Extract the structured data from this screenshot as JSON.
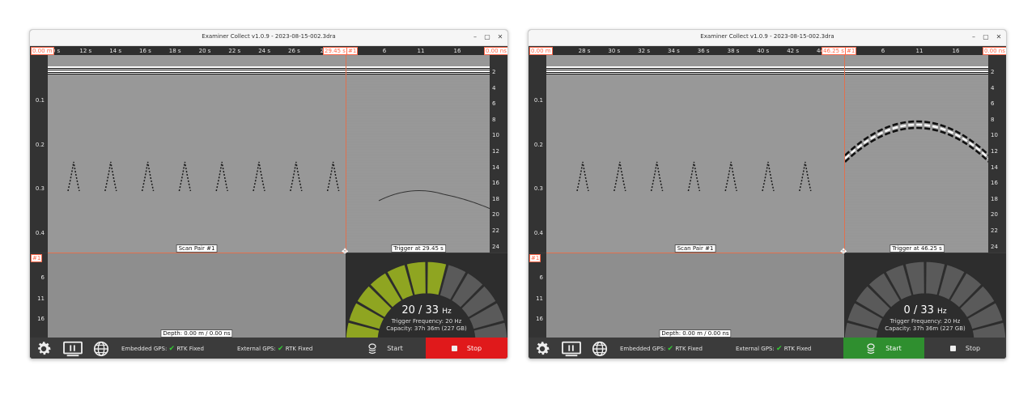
{
  "windows": [
    {
      "title": "Examiner Collect v1.0.9 - 2023-08-15-002.3dra",
      "top_axis_ticks": [
        "0 s",
        "12 s",
        "14 s",
        "16 s",
        "18 s",
        "20 s",
        "22 s",
        "24 s",
        "26 s",
        "28"
      ],
      "start_distance": "0.00 m",
      "cursor_time": "29.45 s",
      "cursor_tag": "#1",
      "ascan_ticks": [
        "6",
        "11",
        "16"
      ],
      "ascan_range": "0.00 ns",
      "depth_ticks": [
        "0.1",
        "0.2",
        "0.3",
        "0.4"
      ],
      "ns_ticks": [
        "2",
        "4",
        "6",
        "8",
        "10",
        "12",
        "14",
        "16",
        "18",
        "20",
        "22",
        "24"
      ],
      "lower_ticks": [
        "6",
        "11",
        "16"
      ],
      "lower_tag": "#1",
      "scan_pair_label": "Scan Pair #1",
      "trigger_label": "Trigger at 29.45 s",
      "depth_label": "Depth: 0.00 m / 0.00 ns",
      "rate_value": "20 / 33",
      "rate_unit": "Hz",
      "trigger_frequency": "Trigger Frequency: 20 Hz",
      "capacity": "Capacity: 37h 36m (227 GB)",
      "gauge_active_fraction": 0.61,
      "embedded_gps_label": "Embedded GPS:",
      "embedded_gps_status": "RTK Fixed",
      "external_gps_label": "External GPS:",
      "external_gps_status": "RTK Fixed",
      "start_label": "Start",
      "stop_label": "Stop",
      "recording": true
    },
    {
      "title": "Examiner Collect v1.0.9 - 2023-08-15-002.3dra",
      "top_axis_ticks": [
        "28 s",
        "30 s",
        "32 s",
        "34 s",
        "36 s",
        "38 s",
        "40 s",
        "42 s",
        "44 s"
      ],
      "start_distance": "0.00 m",
      "cursor_time": "46.25 s",
      "cursor_tag": "#1",
      "ascan_ticks": [
        "6",
        "11",
        "16"
      ],
      "ascan_range": "0.00 ns",
      "depth_ticks": [
        "0.1",
        "0.2",
        "0.3",
        "0.4"
      ],
      "ns_ticks": [
        "2",
        "4",
        "6",
        "8",
        "10",
        "12",
        "14",
        "16",
        "18",
        "20",
        "22",
        "24"
      ],
      "lower_ticks": [
        "6",
        "11",
        "16"
      ],
      "lower_tag": "#1",
      "scan_pair_label": "Scan Pair #1",
      "trigger_label": "Trigger at 46.25 s",
      "depth_label": "Depth: 0.00 m / 0.00 ns",
      "rate_value": "0 / 33",
      "rate_unit": "Hz",
      "trigger_frequency": "Trigger Frequency: 20 Hz",
      "capacity": "Capacity: 37h 36m (227 GB)",
      "gauge_active_fraction": 0,
      "embedded_gps_label": "Embedded GPS:",
      "embedded_gps_status": "RTK Fixed",
      "external_gps_label": "External GPS:",
      "external_gps_status": "RTK Fixed",
      "start_label": "Start",
      "stop_label": "Stop",
      "recording": false
    }
  ],
  "colors": {
    "accent_orange": "#e0704e",
    "gauge_active": "#8fa521",
    "gauge_inactive": "#5a5a5a",
    "stop_red": "#e0191b",
    "start_green": "#2f8f2f",
    "check_green": "#33cc33"
  },
  "icons": [
    "settings-gear-icon",
    "display-icon",
    "globe-icon",
    "satellite-dish-icon",
    "stop-square-icon",
    "move-cross-icon",
    "check-icon"
  ]
}
